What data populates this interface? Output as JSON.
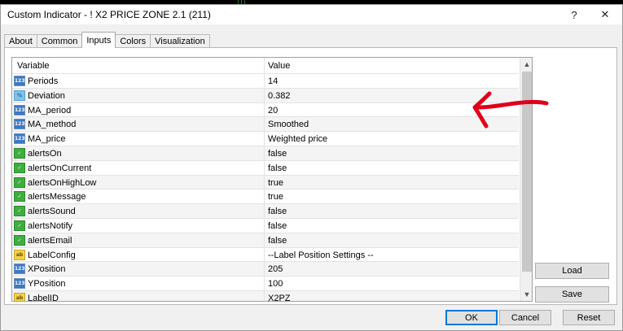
{
  "window": {
    "title": "Custom Indicator - ! X2 PRICE ZONE 2.1 (211)",
    "help_glyph": "?",
    "close_glyph": "✕"
  },
  "tabs": [
    {
      "label": "About",
      "active": false
    },
    {
      "label": "Common",
      "active": false
    },
    {
      "label": "Inputs",
      "active": true
    },
    {
      "label": "Colors",
      "active": false
    },
    {
      "label": "Visualization",
      "active": false
    }
  ],
  "grid": {
    "headers": {
      "variable": "Variable",
      "value": "Value"
    },
    "rows": [
      {
        "type": "int",
        "icon": "123",
        "name": "Periods",
        "value": "14"
      },
      {
        "type": "double",
        "icon": "½",
        "name": "Deviation",
        "value": "0.382"
      },
      {
        "type": "int",
        "icon": "123",
        "name": "MA_period",
        "value": "20"
      },
      {
        "type": "int",
        "icon": "123",
        "name": "MA_method",
        "value": "Smoothed"
      },
      {
        "type": "int",
        "icon": "123",
        "name": "MA_price",
        "value": "Weighted price"
      },
      {
        "type": "bool",
        "icon": "✓",
        "name": "alertsOn",
        "value": "false"
      },
      {
        "type": "bool",
        "icon": "✓",
        "name": "alertsOnCurrent",
        "value": "false"
      },
      {
        "type": "bool",
        "icon": "✓",
        "name": "alertsOnHighLow",
        "value": "true"
      },
      {
        "type": "bool",
        "icon": "✓",
        "name": "alertsMessage",
        "value": "true"
      },
      {
        "type": "bool",
        "icon": "✓",
        "name": "alertsSound",
        "value": "false"
      },
      {
        "type": "bool",
        "icon": "✓",
        "name": "alertsNotify",
        "value": "false"
      },
      {
        "type": "bool",
        "icon": "✓",
        "name": "alertsEmail",
        "value": "false"
      },
      {
        "type": "string",
        "icon": "ab",
        "name": "LabelConfig",
        "value": "--Label Position Settings --"
      },
      {
        "type": "int",
        "icon": "123",
        "name": "XPosition",
        "value": "205"
      },
      {
        "type": "int",
        "icon": "123",
        "name": "YPosition",
        "value": "100"
      },
      {
        "type": "string",
        "icon": "ab",
        "name": "LabelID",
        "value": "X2PZ"
      }
    ]
  },
  "scroll": {
    "up_glyph": "▲",
    "down_glyph": "▼"
  },
  "side_buttons": {
    "load": "Load",
    "save": "Save"
  },
  "footer": {
    "ok": "OK",
    "cancel": "Cancel",
    "reset": "Reset"
  },
  "annotation": {
    "color": "#e0001b",
    "points_to": "MA_period"
  },
  "colors": {
    "accent": "#0078d7",
    "window_bg": "#f0f0f0"
  }
}
